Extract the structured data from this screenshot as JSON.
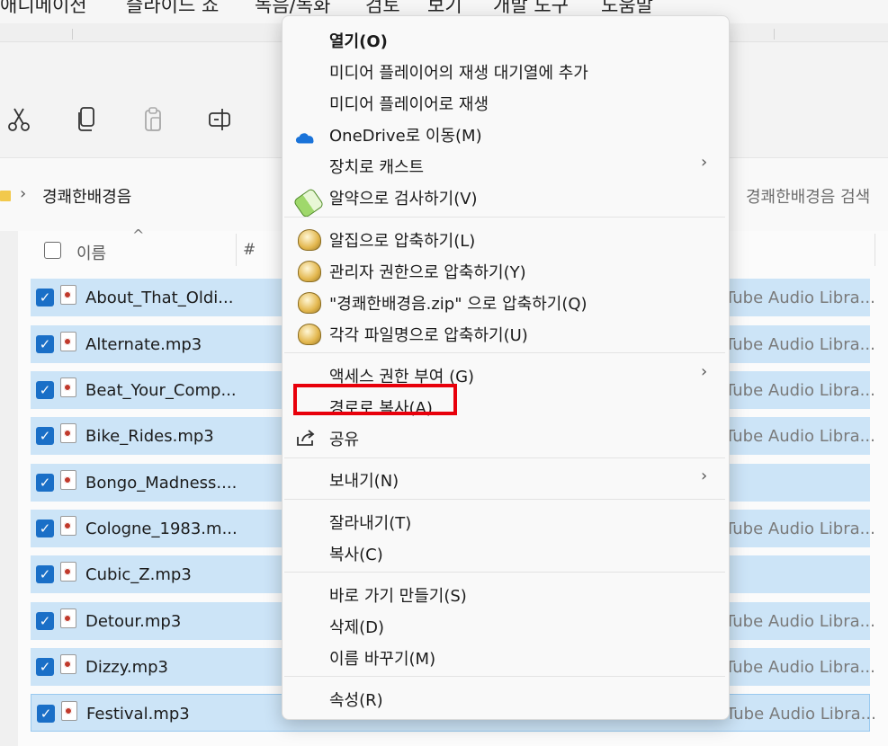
{
  "menubar": {
    "items": [
      "애니메이션",
      "슬라이드 쇼",
      "녹음/녹화",
      "검토",
      "보기",
      "개발 도구",
      "도움말"
    ]
  },
  "address": {
    "path": "경쾌한배경음",
    "search_placeholder": "경쾌한배경음 검색"
  },
  "list_header": {
    "name": "이름",
    "number": "#"
  },
  "files": [
    {
      "name": "About_That_Oldi...",
      "artist": "Tube Audio Libra..."
    },
    {
      "name": "Alternate.mp3",
      "artist": "Tube Audio Libra..."
    },
    {
      "name": "Beat_Your_Comp...",
      "artist": "Tube Audio Libra..."
    },
    {
      "name": "Bike_Rides.mp3",
      "artist": "Tube Audio Libra..."
    },
    {
      "name": "Bongo_Madness....",
      "artist": ""
    },
    {
      "name": "Cologne_1983.m...",
      "artist": "Tube Audio Libra..."
    },
    {
      "name": "Cubic_Z.mp3",
      "artist": ""
    },
    {
      "name": "Detour.mp3",
      "artist": "Tube Audio Libra..."
    },
    {
      "name": "Dizzy.mp3",
      "artist": "Tube Audio Libra..."
    },
    {
      "name": "Festival.mp3",
      "artist": "Tube Audio Libra..."
    }
  ],
  "context_menu": {
    "open": "열기(O)",
    "add_to_queue": "미디어 플레이어의 재생 대기열에 추가",
    "play_media": "미디어 플레이어로 재생",
    "onedrive": "OneDrive로 이동(M)",
    "cast": "장치로 캐스트",
    "scan": "알약으로 검사하기(V)",
    "alzip": "알집으로 압축하기(L)",
    "alzip_admin": "관리자 권한으로 압축하기(Y)",
    "zip_named": "\"경쾌한배경음.zip\" 으로 압축하기(Q)",
    "zip_each": "각각 파일명으로 압축하기(U)",
    "give_access": "액세스 권한 부여 (G)",
    "copy_path": "경로로 복사(A)",
    "share": "공유",
    "send_to": "보내기(N)",
    "cut": "잘라내기(T)",
    "copy": "복사(C)",
    "shortcut": "바로 가기 만들기(S)",
    "delete": "삭제(D)",
    "rename": "이름 바꾸기(M)",
    "properties": "속성(R)"
  },
  "colors": {
    "selection": "#cce4f7",
    "checkbox": "#1a6fc7",
    "highlight_box": "#e8000b"
  }
}
